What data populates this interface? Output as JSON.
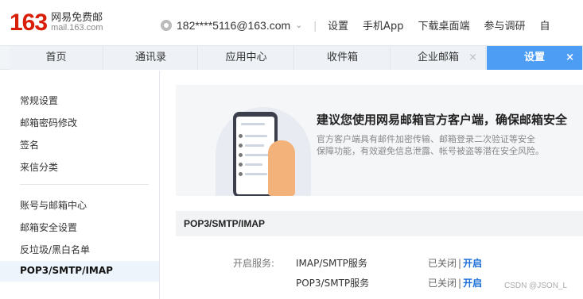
{
  "header": {
    "logo_number": "163",
    "logo_cn": "网易免费邮",
    "logo_en": "mail.163.com",
    "account": "182****5116@163.com",
    "links": [
      "设置",
      "手机App",
      "下载桌面端",
      "参与调研",
      "自"
    ]
  },
  "tabs": [
    {
      "label": "首页"
    },
    {
      "label": "通讯录"
    },
    {
      "label": "应用中心"
    },
    {
      "label": "收件箱"
    },
    {
      "label": "企业邮箱",
      "close": "×"
    },
    {
      "label": "设置",
      "close": "×"
    }
  ],
  "sidebar": {
    "group1": [
      "常规设置",
      "邮箱密码修改",
      "签名",
      "来信分类"
    ],
    "group2": [
      "账号与邮箱中心",
      "邮箱安全设置",
      "反垃圾/黑白名单",
      "POP3/SMTP/IMAP"
    ]
  },
  "banner": {
    "title": "建议您使用网易邮箱官方客户端，确保邮箱安全",
    "desc_line1": "官方客户端具有邮件加密传输、邮箱登录二次验证等安全",
    "desc_line2": "保障功能，有效避免信息泄露、帐号被盗等潜在安全风险。"
  },
  "section": {
    "title": "POP3/SMTP/IMAP",
    "label": "开启服务:",
    "services": [
      {
        "name": "IMAP/SMTP服务",
        "status": "已关闭",
        "pipe": "|",
        "action": "开启"
      },
      {
        "name": "POP3/SMTP服务",
        "status": "已关闭",
        "pipe": "|",
        "action": "开启"
      }
    ]
  },
  "watermark": "CSDN @JSON_L"
}
